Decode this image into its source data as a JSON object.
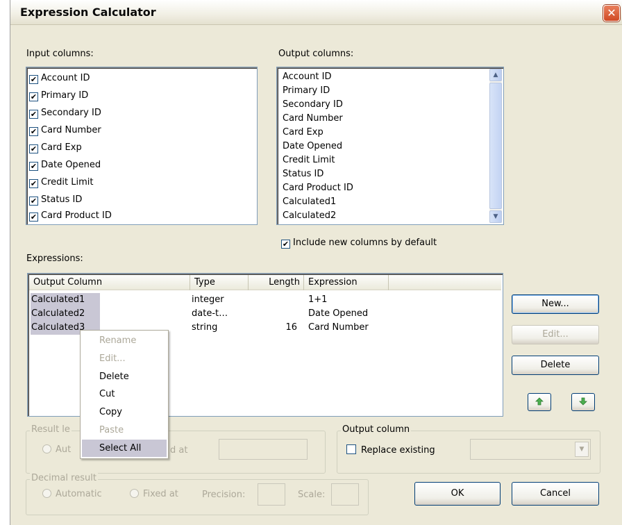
{
  "window": {
    "title": "Expression Calculator",
    "close_glyph": "✕"
  },
  "input_columns": {
    "label": "Input columns:",
    "items": [
      {
        "label": "Account ID",
        "checked": true
      },
      {
        "label": "Primary ID",
        "checked": true
      },
      {
        "label": "Secondary ID",
        "checked": true
      },
      {
        "label": "Card Number",
        "checked": true
      },
      {
        "label": "Card Exp",
        "checked": true
      },
      {
        "label": "Date Opened",
        "checked": true
      },
      {
        "label": "Credit Limit",
        "checked": true
      },
      {
        "label": "Status ID",
        "checked": true
      },
      {
        "label": "Card Product ID",
        "checked": true
      }
    ]
  },
  "output_columns": {
    "label": "Output columns:",
    "items": [
      "Account ID",
      "Primary ID",
      "Secondary ID",
      "Card Number",
      "Card Exp",
      "Date Opened",
      "Credit Limit",
      "Status ID",
      "Card Product ID",
      "Calculated1",
      "Calculated2"
    ]
  },
  "include_new": {
    "label": "Include new columns by default",
    "checked": true
  },
  "expressions": {
    "label": "Expressions:",
    "headers": [
      "Output Column",
      "Type",
      "Length",
      "Expression"
    ],
    "rows": [
      {
        "output": "Calculated1",
        "type": "integer",
        "length": "",
        "expression": "1+1"
      },
      {
        "output": "Calculated2",
        "type": "date-t…",
        "length": "",
        "expression": "Date Opened"
      },
      {
        "output": "Calculated3",
        "type": "string",
        "length": "16",
        "expression": "Card Number"
      }
    ]
  },
  "buttons": {
    "new": "New...",
    "edit": "Edit...",
    "delete": "Delete",
    "move_up_icon": "arrow-up-icon",
    "move_down_icon": "arrow-down-icon",
    "ok": "OK",
    "cancel": "Cancel"
  },
  "context_menu": {
    "items": [
      {
        "label": "Rename",
        "enabled": false
      },
      {
        "label": "Edit...",
        "enabled": false
      },
      {
        "label": "Delete",
        "enabled": true
      },
      {
        "label": "Cut",
        "enabled": true
      },
      {
        "label": "Copy",
        "enabled": true
      },
      {
        "label": "Paste",
        "enabled": false
      },
      {
        "label": "Select All",
        "enabled": true,
        "highlighted": true
      }
    ]
  },
  "result_length": {
    "title": "Result le",
    "automatic_label": "Aut",
    "fixed_label": "d at"
  },
  "output_column_group": {
    "title": "Output column",
    "replace_label": "Replace existing",
    "replace_checked": false
  },
  "decimal_result": {
    "title": "Decimal result",
    "automatic_label": "Automatic",
    "fixed_label": "Fixed at",
    "precision_label": "Precision:",
    "scale_label": "Scale:"
  },
  "colors": {
    "selection": "#c9c7d5",
    "dialog_bg": "#ece9d8",
    "close_button": "#d04a25"
  }
}
